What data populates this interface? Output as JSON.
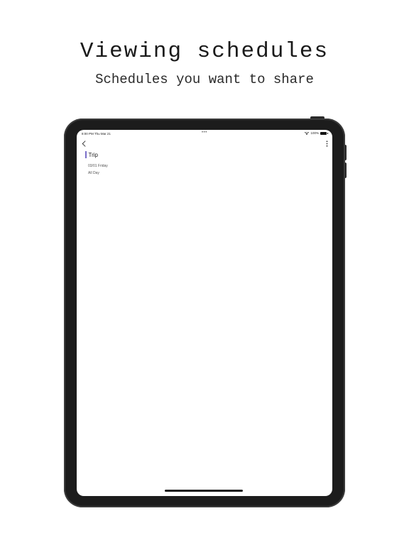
{
  "promo": {
    "headline": "Viewing schedules",
    "subheadline": "Schedules you want to share"
  },
  "statusbar": {
    "time": "8:00 PM   Thu Mar 21",
    "dots": "•••",
    "battery": "100%"
  },
  "nav": {
    "back_icon": "chevron-left-icon",
    "more_icon": "vertical-ellipsis-icon"
  },
  "event": {
    "title": "Trip",
    "date": "03/01 Friday",
    "all_day": "All Day",
    "color": "#7a6fc9"
  }
}
